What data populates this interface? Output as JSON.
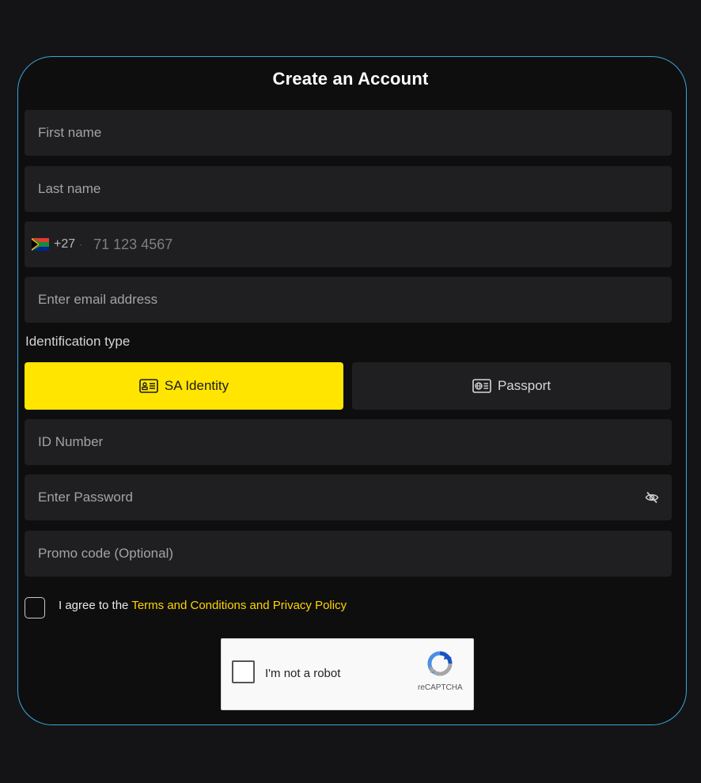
{
  "form": {
    "title": "Create an Account",
    "first_name_placeholder": "First name",
    "last_name_placeholder": "Last name",
    "phone": {
      "country_code": "+27",
      "separator": "·",
      "placeholder": "71 123 4567"
    },
    "email_placeholder": "Enter email address",
    "id_type_label": "Identification type",
    "id_types": [
      {
        "label": "SA Identity",
        "selected": true,
        "icon": "id-card-icon"
      },
      {
        "label": "Passport",
        "selected": false,
        "icon": "passport-icon"
      }
    ],
    "id_number_placeholder": "ID Number",
    "password_placeholder": "Enter Password",
    "promo_placeholder": "Promo code (Optional)",
    "agree_text": "I agree to the",
    "terms_link": "Terms and Conditions and Privacy Policy",
    "captcha": {
      "label": "I'm not a robot",
      "brand": "reCAPTCHA"
    }
  },
  "colors": {
    "accent": "#ffe500",
    "card_border": "#3aa6d8",
    "field_bg": "#1f1f21",
    "link": "#ffd400"
  }
}
